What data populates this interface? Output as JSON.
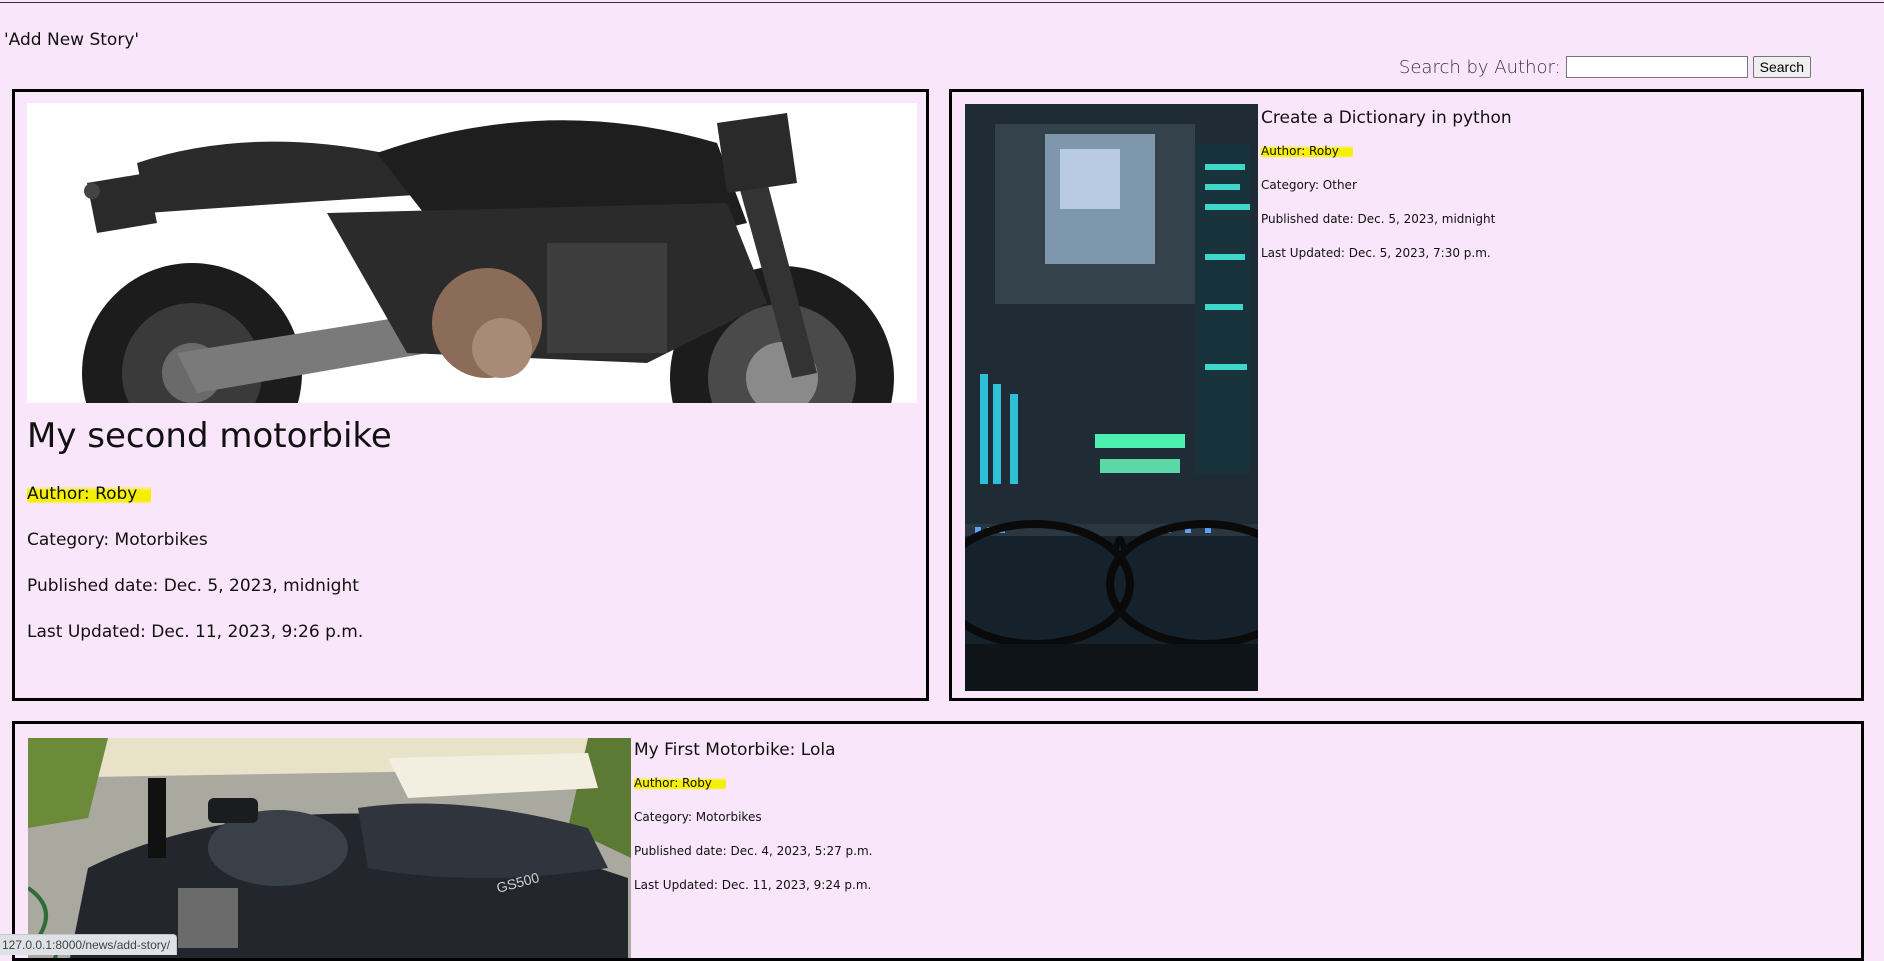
{
  "header": {
    "add_story_link": "'Add New Story'"
  },
  "search": {
    "label": "Search by Author:",
    "input_value": "",
    "button_label": "Search"
  },
  "stories": [
    {
      "title": "My second motorbike",
      "author": "Author: Roby",
      "category": "Category: Motorbikes",
      "published": "Published date: Dec. 5, 2023, midnight",
      "updated": "Last Updated: Dec. 11, 2023, 9:26 p.m.",
      "image": "black-naked-motorbike-photo"
    },
    {
      "title": "Create a Dictionary in python",
      "author": "Author: Roby",
      "category": "Category: Other",
      "published": "Published date: Dec. 5, 2023, midnight",
      "updated": "Last Updated: Dec. 5, 2023, 7:30 p.m.",
      "image": "code-screen-with-glasses-photo"
    },
    {
      "title": "My First Motorbike: Lola",
      "author": "Author: Roby",
      "category": "Category: Motorbikes",
      "published": "Published date: Dec. 4, 2023, 5:27 p.m.",
      "updated": "Last Updated: Dec. 11, 2023, 9:24 p.m.",
      "image": "parked-motorbike-driveway-photo"
    }
  ],
  "status_bar": {
    "url": "127.0.0.1:8000/news/add-story/"
  },
  "colors": {
    "background": "#fae6fa",
    "highlight": "#f5f000",
    "border": "#000000"
  }
}
